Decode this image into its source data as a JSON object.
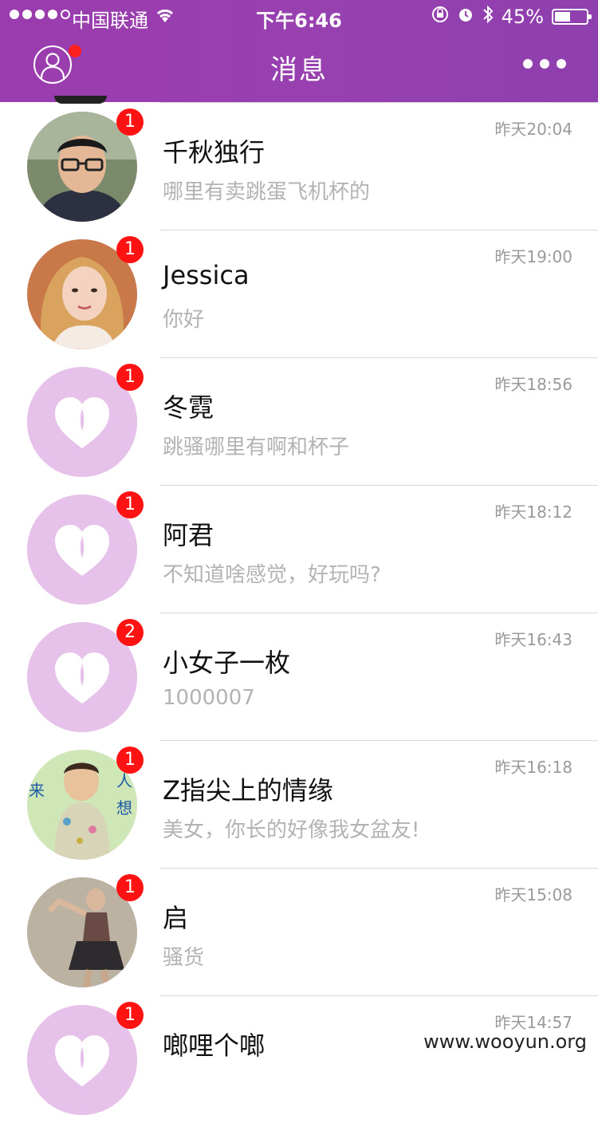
{
  "status_bar": {
    "carrier": "中国联通",
    "time": "下午6:46",
    "battery_text": "45%",
    "battery_level": 0.45
  },
  "nav": {
    "title": "消息",
    "profile_has_notification": true
  },
  "conversations": [
    {
      "name": "千秋独行",
      "message": "哪里有卖跳蛋飞机杯的",
      "time": "昨天20:04",
      "badge": "1",
      "avatar": "photo-man-glasses"
    },
    {
      "name": "Jessica",
      "message": "你好",
      "time": "昨天19:00",
      "badge": "1",
      "avatar": "photo-woman-blonde"
    },
    {
      "name": "冬霓",
      "message": "跳骚哪里有啊和杯子",
      "time": "昨天18:56",
      "badge": "1",
      "avatar": "broken-heart-placeholder"
    },
    {
      "name": "阿君",
      "message": "不知道啥感觉，好玩吗?",
      "time": "昨天18:12",
      "badge": "1",
      "avatar": "broken-heart-placeholder"
    },
    {
      "name": "小女子一枚",
      "message": "1000007",
      "time": "昨天16:43",
      "badge": "2",
      "avatar": "broken-heart-placeholder"
    },
    {
      "name": "Z指尖上的情缘",
      "message": "美女，你长的好像我女盆友!",
      "time": "昨天16:18",
      "badge": "1",
      "avatar": "photo-child"
    },
    {
      "name": "启",
      "message": "骚货",
      "time": "昨天15:08",
      "badge": "1",
      "avatar": "photo-dancer"
    },
    {
      "name": "啷哩个啷",
      "message": "",
      "time": "昨天14:57",
      "badge": "1",
      "avatar": "broken-heart-placeholder"
    }
  ],
  "watermark": "www.wooyun.org",
  "colors": {
    "header": "#9840b0",
    "badge": "#ff1212",
    "placeholder_avatar": "#e6c2ea"
  }
}
